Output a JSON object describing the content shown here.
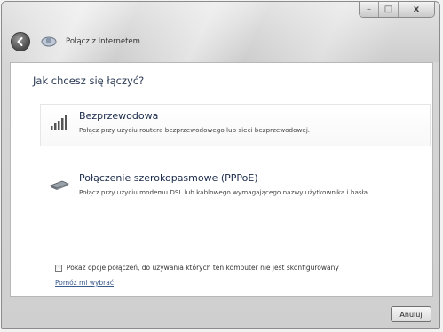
{
  "window": {
    "caption_buttons": {
      "minimize": "–",
      "maximize": "□",
      "close": "x"
    }
  },
  "nav": {
    "back_icon": "back-arrow-icon",
    "network_icon": "network-icon",
    "title": "Połącz z Internetem"
  },
  "main": {
    "heading": "Jak chcesz się łączyć?",
    "options": [
      {
        "icon": "wireless-signal-icon",
        "title": "Bezprzewodowa",
        "description": "Połącz przy użyciu routera bezprzewodowego lub sieci bezprzewodowej."
      },
      {
        "icon": "modem-icon",
        "title": "Połączenie szerokopasmowe (PPPoE)",
        "description": "Połącz przy użyciu modemu DSL lub kablowego wymagającego nazwy użytkownika i hasła."
      }
    ],
    "checkbox_label": "Pokaż opcje połączeń, do używania których ten komputer nie jest skonfigurowany",
    "checkbox_checked": false,
    "help_link": "Pomóż mi wybrać"
  },
  "footer": {
    "cancel_label": "Anuluj"
  }
}
